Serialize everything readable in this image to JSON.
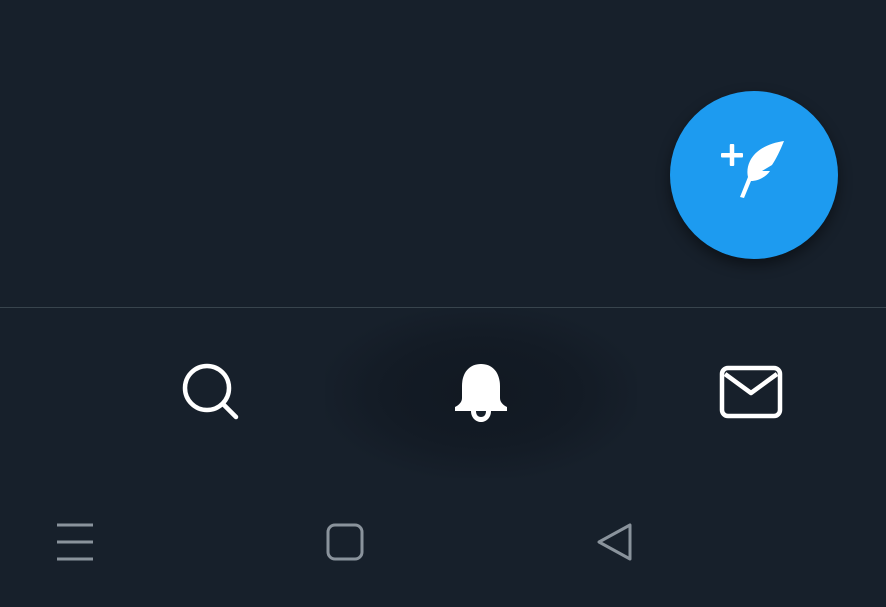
{
  "app": {
    "theme": "dark",
    "background_color": "#17202b",
    "accent_color": "#1d9bf0",
    "divider_color": "#38444d"
  },
  "fab": {
    "icon": "compose-tweet-icon",
    "aria_label": "Compose"
  },
  "tab_bar": {
    "tabs": [
      {
        "id": "search",
        "icon": "search-icon",
        "active": false
      },
      {
        "id": "notifications",
        "icon": "bell-icon",
        "active": true
      },
      {
        "id": "messages",
        "icon": "mail-icon",
        "active": false
      }
    ]
  },
  "system_nav": {
    "buttons": [
      {
        "id": "menu",
        "icon": "menu-icon"
      },
      {
        "id": "home",
        "icon": "home-square-icon"
      },
      {
        "id": "back",
        "icon": "back-triangle-icon"
      }
    ],
    "icon_color": "#8a939c"
  }
}
